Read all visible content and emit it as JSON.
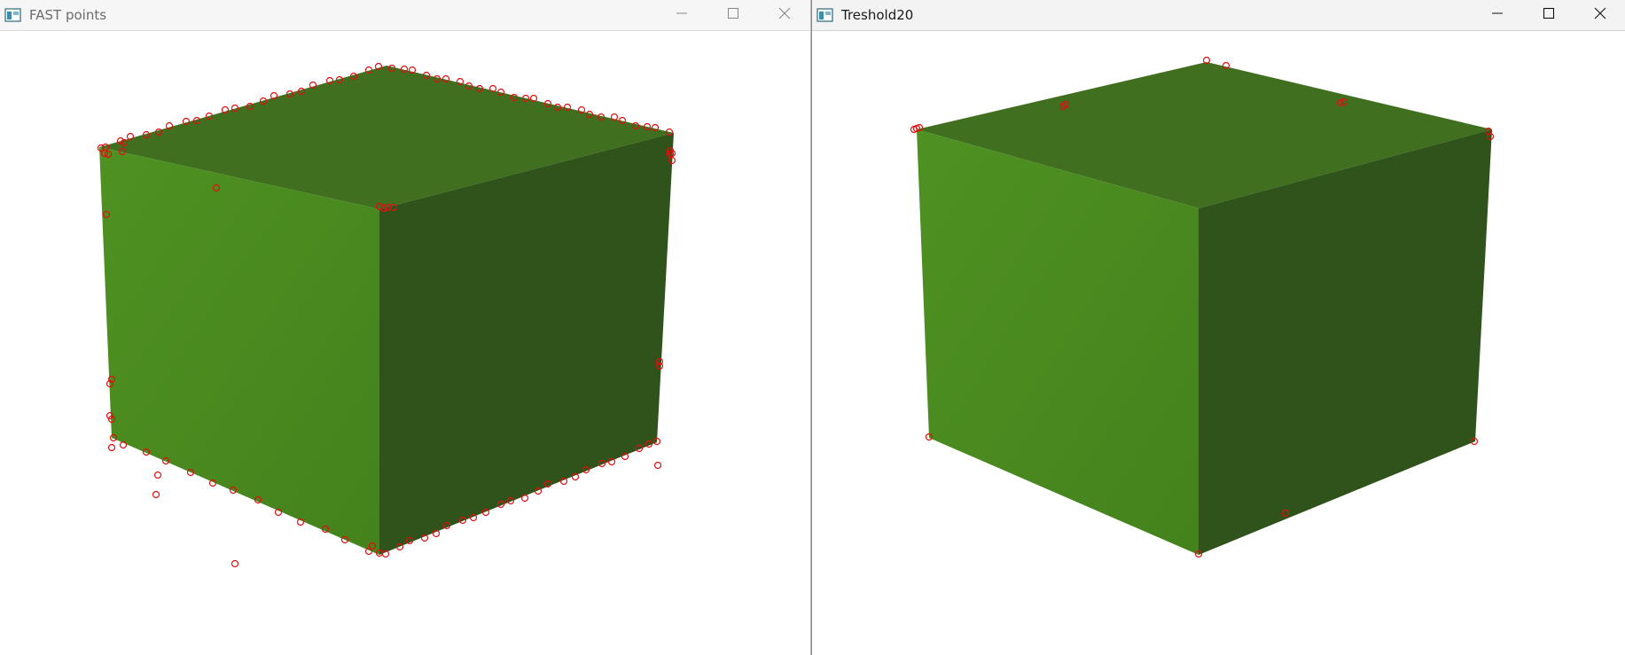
{
  "windows": [
    {
      "title": "FAST points",
      "icons": {
        "app": "opencv-window-icon",
        "minimize": "minimize-icon",
        "maximize": "maximize-icon",
        "close": "close-icon"
      }
    },
    {
      "title": "Treshold20",
      "icons": {
        "app": "opencv-window-icon",
        "minimize": "minimize-icon",
        "maximize": "maximize-icon",
        "close": "close-icon"
      }
    }
  ],
  "colors": {
    "cube_top": "#3f6f1f",
    "cube_left": "#4c8c22",
    "cube_right": "#2f531b",
    "keypoint": "#e01010"
  }
}
